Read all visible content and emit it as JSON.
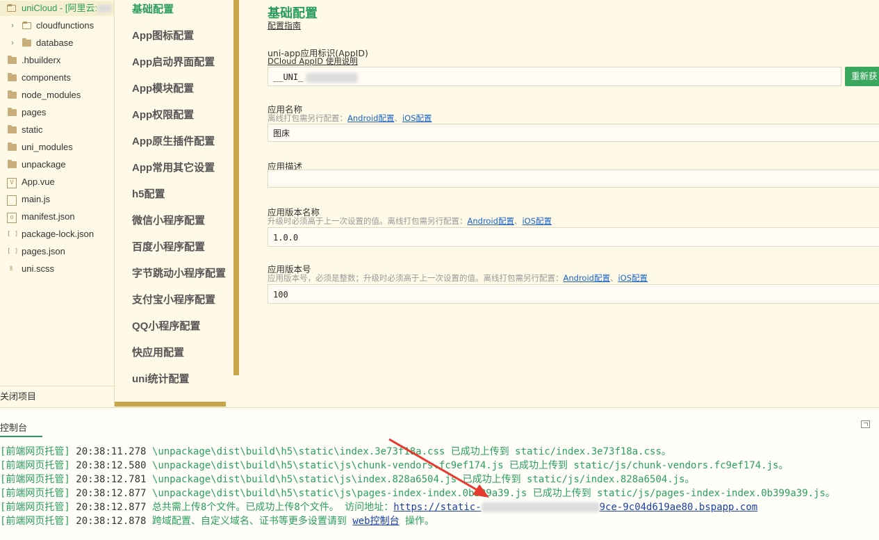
{
  "tree": {
    "root_label": "uniCloud - [阿里云:",
    "items": [
      {
        "label": "cloudfunctions",
        "kind": "folder"
      },
      {
        "label": "database",
        "kind": "folder"
      },
      {
        "label": ".hbuilderx",
        "kind": "folder"
      },
      {
        "label": "components",
        "kind": "folder"
      },
      {
        "label": "node_modules",
        "kind": "folder"
      },
      {
        "label": "pages",
        "kind": "folder"
      },
      {
        "label": "static",
        "kind": "folder"
      },
      {
        "label": "uni_modules",
        "kind": "folder"
      },
      {
        "label": "unpackage",
        "kind": "folder"
      },
      {
        "label": "App.vue",
        "kind": "vue"
      },
      {
        "label": "main.js",
        "kind": "js"
      },
      {
        "label": "manifest.json",
        "kind": "manifest"
      },
      {
        "label": "package-lock.json",
        "kind": "json"
      },
      {
        "label": "pages.json",
        "kind": "json"
      },
      {
        "label": "uni.scss",
        "kind": "scss"
      }
    ],
    "close_project": "关闭项目"
  },
  "nav": {
    "items": [
      "基础配置",
      "App图标配置",
      "App启动界面配置",
      "App模块配置",
      "App权限配置",
      "App原生插件配置",
      "App常用其它设置",
      "h5配置",
      "微信小程序配置",
      "百度小程序配置",
      "字节跳动小程序配置",
      "支付宝小程序配置",
      "QQ小程序配置",
      "快应用配置",
      "uni统计配置"
    ]
  },
  "form": {
    "title": "基础配置",
    "guide_link": "配置指南",
    "appid_label": "uni-app应用标识(AppID)",
    "appid_link": "DCloud AppID 使用说明",
    "appid_value": "__UNI_",
    "regen_button": "重新获",
    "name_label": "应用名称",
    "name_hint": "离线打包需另行配置：",
    "name_value": "图床",
    "desc_label": "应用描述",
    "desc_value": "",
    "version_name_label": "应用版本名称",
    "version_name_hint": "升级时必须高于上一次设置的值。离线打包需另行配置：",
    "version_name_value": "1.0.0",
    "version_code_label": "应用版本号",
    "version_code_hint": "应用版本号，必须是整数；升级时必须高于上一次设置的值。离线打包需另行配置：",
    "version_code_value": "100",
    "android_link": "Android配置",
    "sep": "、",
    "ios_link": "iOS配置"
  },
  "console": {
    "tab": "控制台",
    "logs": [
      {
        "tag": "[前端网页托管]",
        "time": "20:38:11.278",
        "msg": "\\unpackage\\dist\\build\\h5\\static\\index.3e73f18a.css 已成功上传到 static/index.3e73f18a.css。"
      },
      {
        "tag": "[前端网页托管]",
        "time": "20:38:12.580",
        "msg": "\\unpackage\\dist\\build\\h5\\static\\js\\chunk-vendors.fc9ef174.js 已成功上传到 static/js/chunk-vendors.fc9ef174.js。"
      },
      {
        "tag": "[前端网页托管]",
        "time": "20:38:12.781",
        "msg": "\\unpackage\\dist\\build\\h5\\static\\js\\index.828a6504.js 已成功上传到 static/js/index.828a6504.js。"
      },
      {
        "tag": "[前端网页托管]",
        "time": "20:38:12.877",
        "msg": "\\unpackage\\dist\\build\\h5\\static\\js\\pages-index-index.0b399a39.js 已成功上传到 static/js/pages-index-index.0b399a39.js。"
      }
    ],
    "summary": {
      "tag": "[前端网页托管]",
      "time": "20:38:12.877",
      "msg": "总共需上传8个文件。已成功上传8个文件。  访问地址：",
      "url_start": "https://static-",
      "url_end": "9ce-9c04d619ae80.bspapp.com"
    },
    "last": {
      "tag": "[前端网页托管]",
      "time": "20:38:12.878",
      "msg_before": "跨域配置、自定义域名、证书等更多设置请到 ",
      "link": "web控制台",
      "msg_after": " 操作。"
    }
  },
  "colors": {
    "accent": "#2a9d5c",
    "link": "#1a62c4",
    "annotation_arrow": "#e8392e",
    "background": "#fffae8"
  }
}
